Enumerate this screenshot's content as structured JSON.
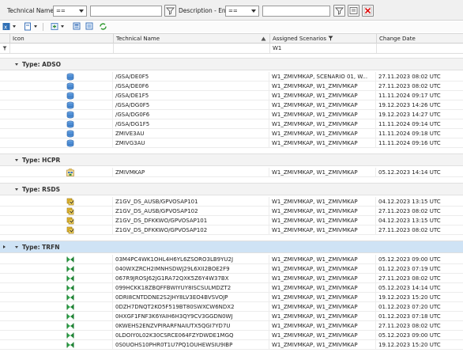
{
  "filter": {
    "tech_label": "Technical Name",
    "tech_op": "==",
    "tech_value": "",
    "desc_label": "Description - En",
    "desc_op": "==",
    "desc_value": ""
  },
  "columns": {
    "icon": "Icon",
    "name": "Technical Name",
    "scenarios": "Assigned Scenarios",
    "date": "Change Date"
  },
  "filter_row": {
    "scenarios": "W1"
  },
  "groups": [
    {
      "label": "Type: ADSO",
      "icon": "database-cylinder-icon",
      "selected": false,
      "rows": [
        {
          "name": "/GSA/DE0F5",
          "scenarios": "W1_ZMIVMKAP, SCENARIO 01, W...",
          "date": "27.11.2023 08:02 UTC"
        },
        {
          "name": "/GSA/DE0F6",
          "scenarios": "W1_ZMIVMKAP, W1_ZMIVMKAP",
          "date": "27.11.2023 08:02 UTC"
        },
        {
          "name": "/GSA/DE1F5",
          "scenarios": "W1_ZMIVMKAP, W1_ZMIVMKAP",
          "date": "11.11.2024 09:17 UTC"
        },
        {
          "name": "/GSA/DG0F5",
          "scenarios": "W1_ZMIVMKAP, W1_ZMIVMKAP",
          "date": "19.12.2023 14:26 UTC"
        },
        {
          "name": "/GSA/DG0F6",
          "scenarios": "W1_ZMIVMKAP, W1_ZMIVMKAP",
          "date": "19.12.2023 14:27 UTC"
        },
        {
          "name": "/GSA/DG1F5",
          "scenarios": "W1_ZMIVMKAP, W1_ZMIVMKAP",
          "date": "11.11.2024 09:14 UTC"
        },
        {
          "name": "ZMIVE3AU",
          "scenarios": "W1_ZMIVMKAP, W1_ZMIVMKAP",
          "date": "11.11.2024 09:18 UTC"
        },
        {
          "name": "ZMIVG3AU",
          "scenarios": "W1_ZMIVMKAP, W1_ZMIVMKAP",
          "date": "11.11.2024 09:16 UTC"
        }
      ]
    },
    {
      "label": "Type: HCPR",
      "icon": "composite-provider-icon",
      "selected": false,
      "rows": [
        {
          "name": "ZMIVMKAP",
          "scenarios": "W1_ZMIVMKAP, W1_ZMIVMKAP",
          "date": "05.12.2023 14:14 UTC"
        }
      ]
    },
    {
      "label": "Type: RSDS",
      "icon": "datasource-icon",
      "selected": false,
      "rows": [
        {
          "name": "Z1GV_DS_AUSB/GPVOSAP101",
          "scenarios": "W1_ZMIVMKAP, W1_ZMIVMKAP",
          "date": "04.12.2023 13:15 UTC"
        },
        {
          "name": "Z1GV_DS_AUSB/GPVOSAP102",
          "scenarios": "W1_ZMIVMKAP, W1_ZMIVMKAP",
          "date": "27.11.2023 08:02 UTC"
        },
        {
          "name": "Z1GV_DS_DFKKWO/GPVOSAP101",
          "scenarios": "W1_ZMIVMKAP, W1_ZMIVMKAP",
          "date": "04.12.2023 13:15 UTC"
        },
        {
          "name": "Z1GV_DS_DFKKWO/GPVOSAP102",
          "scenarios": "W1_ZMIVMKAP, W1_ZMIVMKAP",
          "date": "27.11.2023 08:02 UTC"
        }
      ]
    },
    {
      "label": "Type: TRFN",
      "icon": "transformation-icon",
      "selected": true,
      "rows": [
        {
          "name": "03M4PC4WK1OHL4H6YL6ZSORO3LB9YU2J",
          "scenarios": "W1_ZMIVMKAP, W1_ZMIVMKAP",
          "date": "05.12.2023 09:00 UTC"
        },
        {
          "name": "040WXZRCH2IMNHSDWJ29L6XII2BOE2F9",
          "scenarios": "W1_ZMIVMKAP, W1_ZMIVMKAP",
          "date": "01.12.2023 07:19 UTC"
        },
        {
          "name": "067R9JROSJ62JG1RA72QXK5Z6Y4W37BX",
          "scenarios": "W1_ZMIVMKAP, W1_ZMIVMKAP",
          "date": "27.11.2023 08:02 UTC"
        },
        {
          "name": "099HCKK18ZBQFFBWIYUY8ISCSULMDZT2",
          "scenarios": "W1_ZMIVMKAP, W1_ZMIVMKAP",
          "date": "05.12.2023 14:14 UTC"
        },
        {
          "name": "0DRI8CNTDDNE2S2JHY8LV3EO4BVSVOJP",
          "scenarios": "W1_ZMIVMKAP, W1_ZMIVMKAP",
          "date": "19.12.2023 15:20 UTC"
        },
        {
          "name": "0DZH7DNQT2KO5F519BT80SWXCW6NDX2",
          "scenarios": "W1_ZMIVMKAP, W1_ZMIVMKAP",
          "date": "01.12.2023 07:20 UTC"
        },
        {
          "name": "0HXGF1FNF3K6YAIH6H3QY9CV3GGDN0WJ",
          "scenarios": "W1_ZMIVMKAP, W1_ZMIVMKAP",
          "date": "01.12.2023 07:18 UTC"
        },
        {
          "name": "0KWEHS2ENZVPIRARFNAIUTX5QGI7YD7U",
          "scenarios": "W1_ZMIVMKAP, W1_ZMIVMKAP",
          "date": "27.11.2023 08:02 UTC"
        },
        {
          "name": "0LDOIY0L02K30CSRCE064FZYDWDE1MGQ",
          "scenarios": "W1_ZMIVMKAP, W1_ZMIVMKAP",
          "date": "05.12.2023 09:00 UTC"
        },
        {
          "name": "0S0UOHS10PHR0T1U7PQ1OUHEWSIU9IBP",
          "scenarios": "W1_ZMIVMKAP, W1_ZMIVMKAP",
          "date": "19.12.2023 15:20 UTC"
        }
      ]
    }
  ]
}
